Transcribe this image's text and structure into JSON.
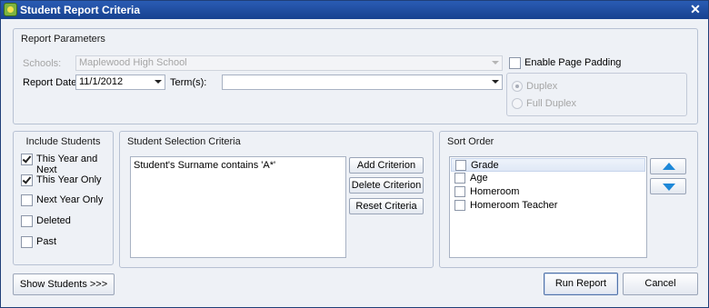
{
  "window": {
    "title": "Student Report Criteria",
    "close_glyph": "✕"
  },
  "report_parameters": {
    "title": "Report Parameters",
    "schools_label": "Schools:",
    "schools_value": "Maplewood High School",
    "report_date_label": "Report Date:",
    "report_date_value": "11/1/2012",
    "terms_label": "Term(s):",
    "terms_value": "",
    "enable_page_padding_label": "Enable Page Padding",
    "enable_page_padding_checked": false,
    "duplex_label": "Duplex",
    "full_duplex_label": "Full Duplex"
  },
  "include_students": {
    "title": "Include Students",
    "items": [
      {
        "label": "This Year and Next",
        "checked": true
      },
      {
        "label": "This Year Only",
        "checked": true
      },
      {
        "label": "Next Year Only",
        "checked": false
      },
      {
        "label": "Deleted",
        "checked": false
      },
      {
        "label": "Past",
        "checked": false
      }
    ]
  },
  "selection_criteria": {
    "title": "Student Selection Criteria",
    "criteria": [
      "Student's Surname contains 'A*'"
    ],
    "add_label": "Add Criterion",
    "delete_label": "Delete Criterion",
    "reset_label": "Reset Criteria"
  },
  "sort_order": {
    "title": "Sort Order",
    "items": [
      {
        "label": "Grade",
        "checked": false,
        "selected": true
      },
      {
        "label": "Age",
        "checked": false,
        "selected": false
      },
      {
        "label": "Homeroom",
        "checked": false,
        "selected": false
      },
      {
        "label": "Homeroom Teacher",
        "checked": false,
        "selected": false
      }
    ],
    "move_up_icon": "triangle-up-icon",
    "move_down_icon": "triangle-down-icon",
    "arrow_color": "#1e88d8"
  },
  "footer": {
    "show_students_label": "Show Students >>>",
    "run_report_label": "Run Report",
    "cancel_label": "Cancel"
  }
}
